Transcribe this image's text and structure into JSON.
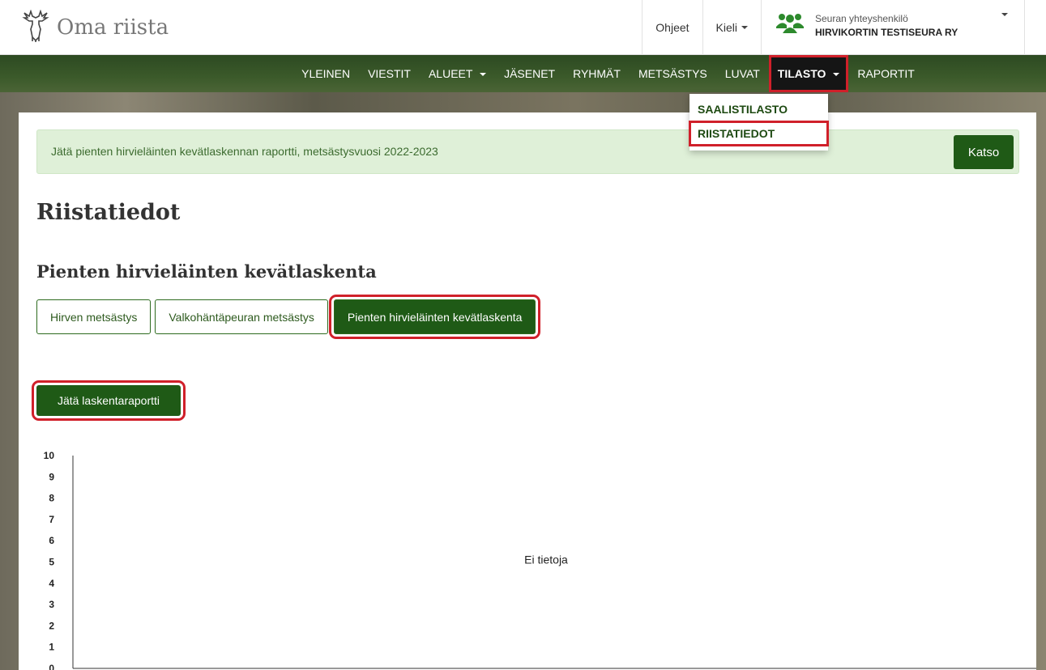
{
  "app": {
    "title": "Oma riista"
  },
  "topnav": {
    "help": "Ohjeet",
    "language": "Kieli",
    "user_role": "Seuran yhteyshenkilö",
    "club_name": "HIRVIKORTIN TESTISEURA RY"
  },
  "mainnav": {
    "items": [
      "YLEINEN",
      "VIESTIT",
      "ALUEET",
      "JÄSENET",
      "RYHMÄT",
      "METSÄSTYS",
      "LUVAT",
      "TILASTO",
      "RAPORTIT"
    ],
    "active": "TILASTO"
  },
  "dropdown": {
    "items": [
      "SAALISTILASTO",
      "RIISTATIEDOT"
    ],
    "highlighted": "RIISTATIEDOT"
  },
  "alert": {
    "text": "Jätä pienten hirvieläinten kevätlaskennan raportti, metsästysvuosi 2022-2023",
    "button": "Katso"
  },
  "page": {
    "title": "Riistatiedot",
    "section_title": "Pienten hirvieläinten kevätlaskenta",
    "tabs": [
      "Hirven metsästys",
      "Valkohäntäpeuran metsästys",
      "Pienten hirvieläinten kevätlaskenta"
    ],
    "active_tab": "Pienten hirvieläinten kevätlaskenta",
    "report_button": "Jätä laskentaraportti"
  },
  "chart_data": {
    "type": "bar",
    "categories": [],
    "values": [],
    "ylim": [
      0,
      10
    ],
    "yticks": [
      0,
      1,
      2,
      3,
      4,
      5,
      6,
      7,
      8,
      9,
      10
    ],
    "empty_message": "Ei tietoja"
  },
  "colors": {
    "primary": "#1f5a16",
    "highlight": "#d0202a",
    "alert_bg": "#dff0d8"
  }
}
